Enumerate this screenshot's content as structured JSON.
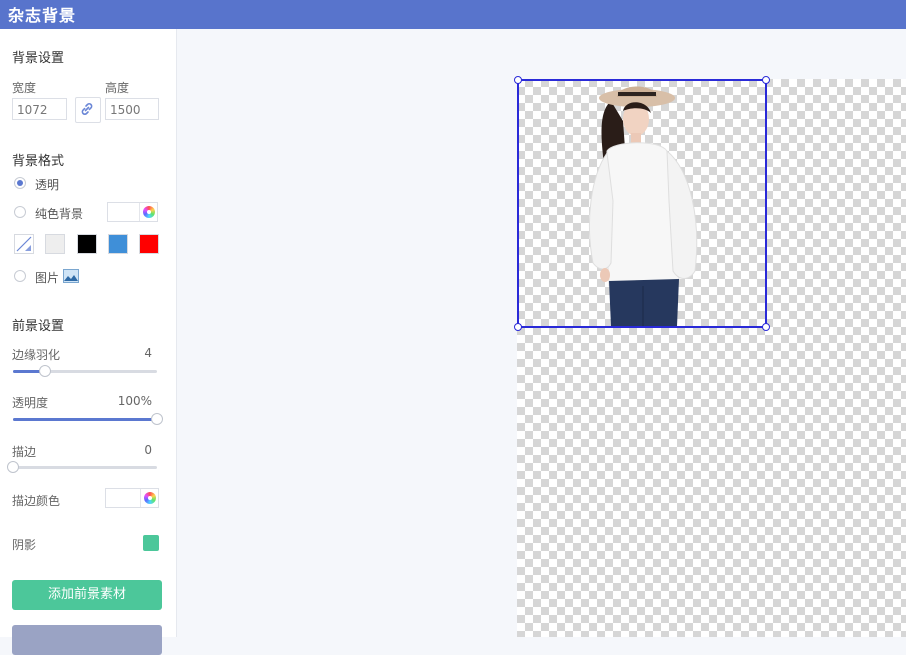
{
  "app": {
    "title": "杂志背景"
  },
  "background_settings": {
    "title": "背景设置",
    "width_label": "宽度",
    "width_value": "1072",
    "height_label": "高度",
    "height_value": "1500"
  },
  "background_format": {
    "title": "背景格式",
    "options": {
      "transparent": "透明",
      "solid": "纯色背景",
      "image": "图片"
    },
    "selected": "transparent",
    "swatches": [
      "transparent",
      "#eeeeee",
      "#000000",
      "#3f8fd8",
      "#ff0000"
    ]
  },
  "foreground_settings": {
    "title": "前景设置",
    "feather": {
      "label": "边缘羽化",
      "value": "4",
      "fraction": 0.22
    },
    "opacity": {
      "label": "透明度",
      "value": "100%",
      "fraction": 1.0
    },
    "stroke": {
      "label": "描边",
      "value": "0",
      "fraction": 0.0
    },
    "stroke_color_label": "描边颜色",
    "shadow_label": "阴影",
    "shadow_color": "#4cc79a"
  },
  "buttons": {
    "add_foreground": "添加前景素材"
  },
  "colors": {
    "header": "#5874cc",
    "accent": "#5b78d0",
    "primary_button": "#4cc79a",
    "secondary_button": "#9aa3c4",
    "selection": "#2a2ad8"
  }
}
